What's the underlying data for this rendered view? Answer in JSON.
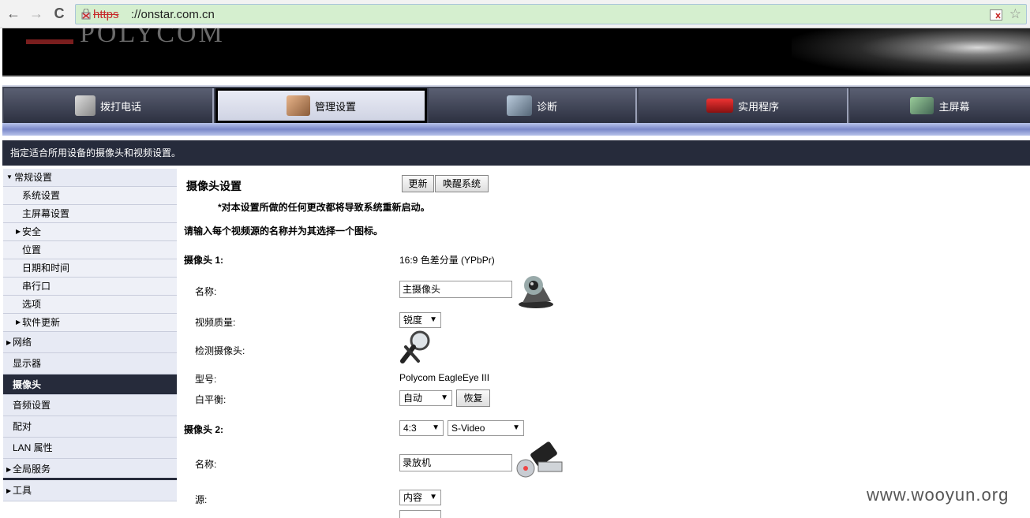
{
  "browser": {
    "back": "←",
    "forward": "→",
    "reload": "C",
    "url_scheme": "https",
    "url_rest": "://onstar.com.cn",
    "star": "☆"
  },
  "banner": {
    "logo_text": "POLYCOM"
  },
  "topnav": {
    "tabs": [
      {
        "label": "拨打电话",
        "icon": "phone-icon"
      },
      {
        "label": "管理设置",
        "icon": "admin-settings-icon"
      },
      {
        "label": "诊断",
        "icon": "diagnostics-icon"
      },
      {
        "label": "实用程序",
        "icon": "utilities-icon"
      },
      {
        "label": "主屏幕",
        "icon": "home-screen-icon"
      }
    ],
    "active_index": 1
  },
  "infobar": {
    "text": "指定适合所用设备的摄像头和视频设置。"
  },
  "sidebar": {
    "items": [
      {
        "label": "常规设置"
      },
      {
        "label": "系统设置"
      },
      {
        "label": "主屏幕设置"
      },
      {
        "label": "安全"
      },
      {
        "label": "位置"
      },
      {
        "label": "日期和时间"
      },
      {
        "label": "串行口"
      },
      {
        "label": "选项"
      },
      {
        "label": "软件更新"
      },
      {
        "label": "网络"
      },
      {
        "label": "显示器"
      },
      {
        "label": "摄像头"
      },
      {
        "label": "音频设置"
      },
      {
        "label": "配对"
      },
      {
        "label": "LAN 属性"
      },
      {
        "label": "全局服务"
      },
      {
        "label": "工具"
      }
    ]
  },
  "main": {
    "title": "摄像头设置",
    "update_button": "更新",
    "wake_button": "唤醒系统",
    "warning": "*对本设置所做的任何更改都将导致系统重新启动。",
    "instruction": "请输入每个视频源的名称并为其选择一个图标。",
    "camera1": {
      "label": "摄像头 1:",
      "mode": "16:9 色差分量 (YPbPr)",
      "name_label": "名称:",
      "name_value": "主摄像头",
      "quality_label": "视频质量:",
      "quality_value": "锐度",
      "detect_label": "检测摄像头:",
      "model_label": "型号:",
      "model_value": "Polycom EagleEye III",
      "wb_label": "白平衡:",
      "wb_value": "自动",
      "restore_button": "恢复"
    },
    "camera2": {
      "label": "摄像头 2:",
      "aspect_value": "4:3",
      "type_value": "S-Video",
      "name_label": "名称:",
      "name_value": "录放机",
      "source_label": "源:",
      "source_value": "内容"
    }
  },
  "watermark": "www.wooyun.org"
}
